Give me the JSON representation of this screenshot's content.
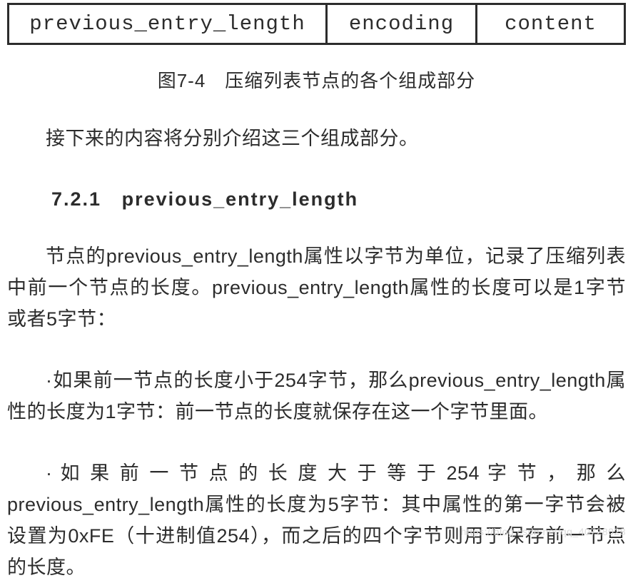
{
  "diagram": {
    "cells": [
      "previous_entry_length",
      "encoding",
      "content"
    ]
  },
  "caption": "图7-4　压缩列表节点的各个组成部分",
  "intro": "接下来的内容将分别介绍这三个组成部分。",
  "section": {
    "number": "7.2.1",
    "title": "previous_entry_length"
  },
  "paragraphs": {
    "p1": "节点的previous_entry_length属性以字节为单位，记录了压缩列表中前一个节点的长度。previous_entry_length属性的长度可以是1字节或者5字节：",
    "p2": "·如果前一节点的长度小于254字节，那么previous_entry_length属性的长度为1字节：前一节点的长度就保存在这一个字节里面。",
    "p3": "· 如 果 前 一 节 点 的 长 度 大 于 等 于 254 字 节 ， 那 么previous_entry_length属性的长度为5字节：其中属性的第一字节会被设置为0xFE（十进制值254），而之后的四个字节则用于保存前一节点的长度。"
  },
  "watermark": "https://blog.csdn.net/qq_40728028"
}
